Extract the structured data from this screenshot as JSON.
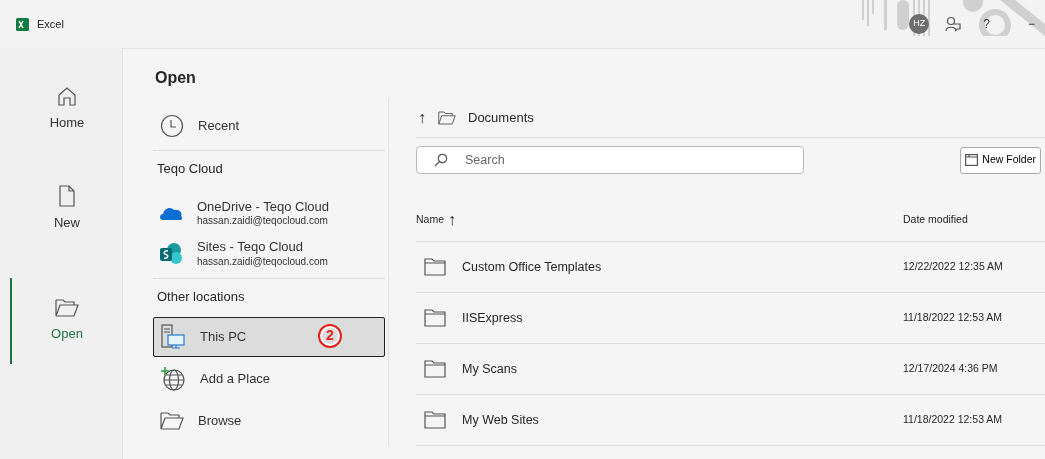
{
  "window": {
    "title": "Excel"
  },
  "account": {
    "initials": "HZ"
  },
  "titlebar_buttons": [
    {
      "kind": "help",
      "label": "?"
    },
    {
      "kind": "minimize",
      "label": "−"
    }
  ],
  "nav": [
    {
      "label": "Home",
      "selected": false
    },
    {
      "label": "New",
      "selected": false
    },
    {
      "label": "Open",
      "selected": true
    }
  ],
  "page_title": "Open",
  "places": [
    {
      "kind": "item",
      "label": "Recent",
      "selected": false
    },
    {
      "kind": "heading",
      "label": "Teqo Cloud"
    },
    {
      "kind": "account",
      "label": "OneDrive - Teqo Cloud",
      "sublabel": "hassan.zaidi@teqocloud.com"
    },
    {
      "kind": "account",
      "label": "Sites - Teqo Cloud",
      "sublabel": "hassan.zaidi@teqocloud.com"
    },
    {
      "kind": "heading",
      "label": "Other locations"
    },
    {
      "kind": "item",
      "label": "This PC",
      "selected": true,
      "callout": "2"
    },
    {
      "kind": "item",
      "label": "Add a Place",
      "selected": false
    },
    {
      "kind": "item",
      "label": "Browse",
      "selected": false
    }
  ],
  "browser": {
    "up_arrow": "↑",
    "path": "Documents",
    "search": {
      "placeholder": "Search"
    },
    "new_folder": "New Folder",
    "columns": [
      {
        "label": "Name",
        "sort": "↑"
      },
      {
        "label": "Date modified"
      }
    ],
    "files": [
      {
        "name": "Custom Office Templates",
        "modified": "12/22/2022 12:35 AM"
      },
      {
        "name": "IISExpress",
        "modified": "11/18/2022 12:53 AM"
      },
      {
        "name": "My Scans",
        "modified": "12/17/2024 4:36 PM"
      },
      {
        "name": "My Web Sites",
        "modified": "11/18/2022 12:53 AM"
      }
    ]
  }
}
